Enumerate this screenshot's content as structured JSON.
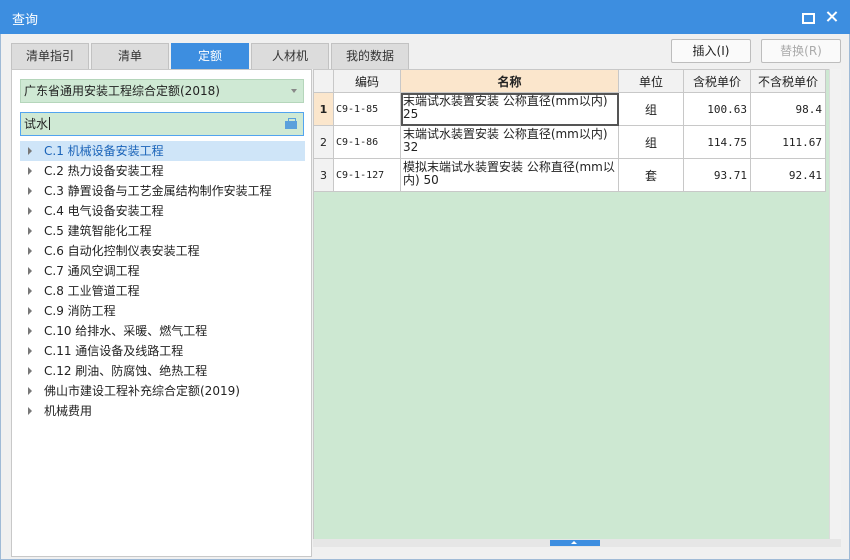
{
  "window": {
    "title": "查询"
  },
  "tabs": [
    {
      "label": "清单指引"
    },
    {
      "label": "清单"
    },
    {
      "label": "定额"
    },
    {
      "label": "人材机"
    },
    {
      "label": "我的数据"
    }
  ],
  "buttons": {
    "insert": "插入(I)",
    "replace": "替换(R)"
  },
  "left": {
    "library": "广东省通用安装工程综合定额(2018)",
    "search_value": "试水",
    "tree": [
      {
        "label": "C.1 机械设备安装工程"
      },
      {
        "label": "C.2 热力设备安装工程"
      },
      {
        "label": "C.3 静置设备与工艺金属结构制作安装工程"
      },
      {
        "label": "C.4 电气设备安装工程"
      },
      {
        "label": "C.5 建筑智能化工程"
      },
      {
        "label": "C.6 自动化控制仪表安装工程"
      },
      {
        "label": "C.7 通风空调工程"
      },
      {
        "label": "C.8 工业管道工程"
      },
      {
        "label": "C.9 消防工程"
      },
      {
        "label": "C.10 给排水、采暖、燃气工程"
      },
      {
        "label": "C.11 通信设备及线路工程"
      },
      {
        "label": "C.12 刷油、防腐蚀、绝热工程"
      },
      {
        "label": "佛山市建设工程补充综合定额(2019)"
      },
      {
        "label": "机械费用"
      }
    ]
  },
  "grid": {
    "headers": {
      "code": "编码",
      "name": "名称",
      "unit": "单位",
      "price_tax": "含税单价",
      "price_notax": "不含税单价"
    },
    "rows": [
      {
        "num": "1",
        "code": "C9-1-85",
        "name": "末端试水装置安装 公称直径(mm以内) 25",
        "unit": "组",
        "price_tax": "100.63",
        "price_notax": "98.4"
      },
      {
        "num": "2",
        "code": "C9-1-86",
        "name": "末端试水装置安装 公称直径(mm以内) 32",
        "unit": "组",
        "price_tax": "114.75",
        "price_notax": "111.67"
      },
      {
        "num": "3",
        "code": "C9-1-127",
        "name": "模拟末端试水装置安装 公称直径(mm以内) 50",
        "unit": "套",
        "price_tax": "93.71",
        "price_notax": "92.41"
      }
    ]
  }
}
